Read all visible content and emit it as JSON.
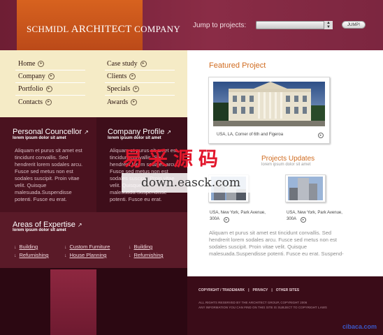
{
  "logo": {
    "line_prefix": "SCHMIDL ",
    "line_big": "ARCHITECT",
    "line_suffix": " COMPANY"
  },
  "jump": {
    "label": "Jump to projects:",
    "select_value": "",
    "button": "JUMP!"
  },
  "nav": {
    "col1": [
      "Home",
      "Company",
      "Portfolio",
      "Contacts"
    ],
    "col2": [
      "Case study",
      "Clients",
      "Specials",
      "Awards"
    ]
  },
  "personal": {
    "title": "Personal Councellor",
    "subtitle": "lorem ipsum dolor sit amet",
    "body": "Aliquam et purus sit amet est tincidunt convallis. Sed hendrerit lorem sodales arcu. Fusce sed metus non est sodales suscipit. Proin vitae velit. Quisque malesuada.Suspendisse potenti. Fusce eu erat."
  },
  "company": {
    "title": "Company Profile",
    "subtitle": "lorem ipsum dolor sit amet",
    "body": "Aliquam et purus sit amet est tincidunt convallis. Sed hendrerit lorem sodales arcu. Fusce sed metus non est sodales suscipit. Proin vitae velit. Quisque malesuada.Suspendisse potenti. Fusce eu erat."
  },
  "areas": {
    "title": "Areas of Expertise",
    "subtitle": "lorem ipsum dolor sit amet",
    "links": [
      "Building",
      "Custom Furniture",
      "Building",
      "Refurnishing",
      "House Planning",
      "Refurnishing"
    ]
  },
  "featured": {
    "title": "Featured Project",
    "caption": "USA, LA, Corner of 6th and Figeroa"
  },
  "updates": {
    "title": "Projects Updates",
    "subtitle": "lorem ipsum dolor sit amet",
    "items": [
      {
        "caption": "USA, New York, Park Avenue, 300A"
      },
      {
        "caption": "USA, New York, Park Avenue, 300A"
      }
    ]
  },
  "right_body": "Aliquam et purus sit amet est tincidunt convallis. Sed hendrerit lorem sodales arcu. Fusce sed metus non est sodales suscipit. Proin vitae velit. Quisque malesuada.Suspendisse potenti. Fusce eu erat. Suspend-",
  "footer": {
    "links": [
      "COPYRIGHT / TRADEMARK",
      "PRIVACY",
      "OTHER SITES"
    ],
    "copy_1": "ALL RIGHTS RESERVED BY THE ARCHITECT GROUP, COPYRIGHT 2006",
    "copy_2": "ANY INFORMATION YOU CAN FIND ON THIS SITE IS SUBJECT TO COPYRIGHT LAWS"
  },
  "watermark": {
    "cn": "易采源码",
    "en": "down.easck.com",
    "corner": "cibaca.com"
  },
  "icons": {
    "nav_arrow": "circle-arrow-icon",
    "ext_link": "external-link-icon",
    "chevron": "chevron-right-icon"
  },
  "colors": {
    "accent": "#d06b1f",
    "nav_bg": "#f5ebc6",
    "dark": "#3e0e1a"
  }
}
